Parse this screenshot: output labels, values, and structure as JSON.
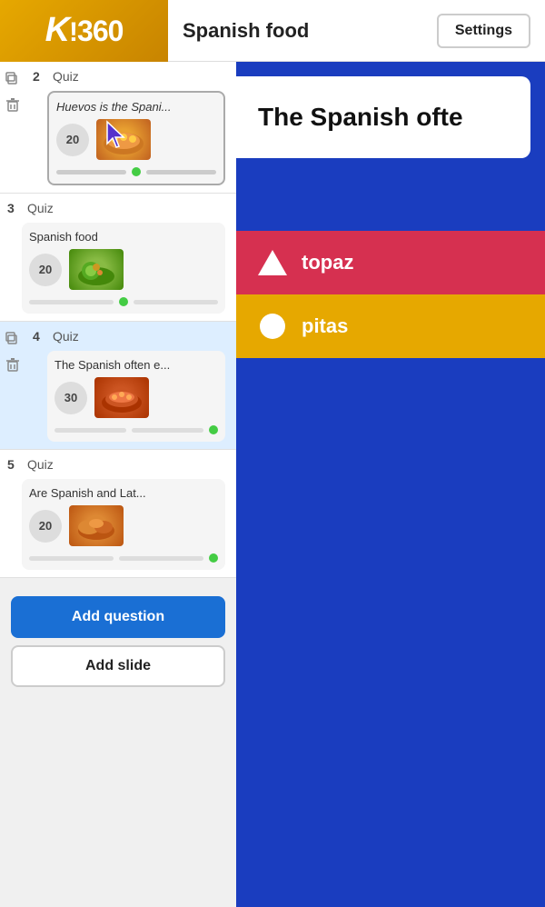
{
  "header": {
    "logo": "K!360",
    "title": "Spanish food",
    "settings_label": "Settings"
  },
  "sidebar": {
    "items": [
      {
        "num": "2",
        "type": "Quiz",
        "card_title": "Huevos is the Spani...",
        "card_title_italic": true,
        "points": "20",
        "selected": true,
        "food_class": "food1"
      },
      {
        "num": "3",
        "type": "Quiz",
        "card_title": "Spanish food",
        "card_title_italic": false,
        "points": "20",
        "selected": false,
        "food_class": "food2"
      },
      {
        "num": "4",
        "type": "Quiz",
        "card_title": "The Spanish often e...",
        "card_title_italic": false,
        "points": "30",
        "selected": false,
        "active": true,
        "food_class": "food3"
      },
      {
        "num": "5",
        "type": "Quiz",
        "card_title": "Are Spanish and Lat...",
        "card_title_italic": false,
        "points": "20",
        "selected": false,
        "food_class": "food4"
      }
    ],
    "add_question_label": "Add question",
    "add_slide_label": "Add slide"
  },
  "preview": {
    "question_text": "The Spanish ofte",
    "answers": [
      {
        "shape": "triangle",
        "text": "topaz",
        "color": "red"
      },
      {
        "shape": "circle",
        "text": "pitas",
        "color": "gold"
      }
    ]
  }
}
